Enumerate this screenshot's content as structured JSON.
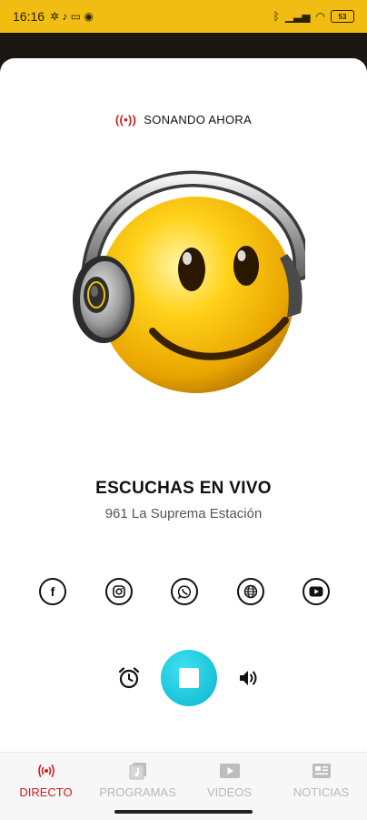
{
  "status_bar": {
    "time": "16:16",
    "battery": "53"
  },
  "now_playing": {
    "label": "SONANDO AHORA",
    "icon": "live-broadcast-icon"
  },
  "station": {
    "title": "ESCUCHAS EN VIVO",
    "subtitle": "961 La Suprema Estación"
  },
  "socials": [
    {
      "name": "facebook-icon",
      "glyph": "f"
    },
    {
      "name": "instagram-icon",
      "glyph": ""
    },
    {
      "name": "whatsapp-icon",
      "glyph": ""
    },
    {
      "name": "website-icon",
      "glyph": ""
    },
    {
      "name": "youtube-icon",
      "glyph": ""
    }
  ],
  "controls": {
    "alarm_icon": "alarm-clock-icon",
    "play_state": "stop",
    "volume_icon": "volume-icon"
  },
  "nav": {
    "items": [
      {
        "label": "DIRECTO",
        "icon": "live-icon",
        "active": true
      },
      {
        "label": "PROGRAMAS",
        "icon": "programs-icon",
        "active": false
      },
      {
        "label": "VIDEOS",
        "icon": "video-icon",
        "active": false
      },
      {
        "label": "NOTICIAS",
        "icon": "news-icon",
        "active": false
      }
    ]
  },
  "colors": {
    "status_bar": "#f1bd12",
    "accent": "#d21c1c",
    "play_button": "#14bfd8"
  }
}
